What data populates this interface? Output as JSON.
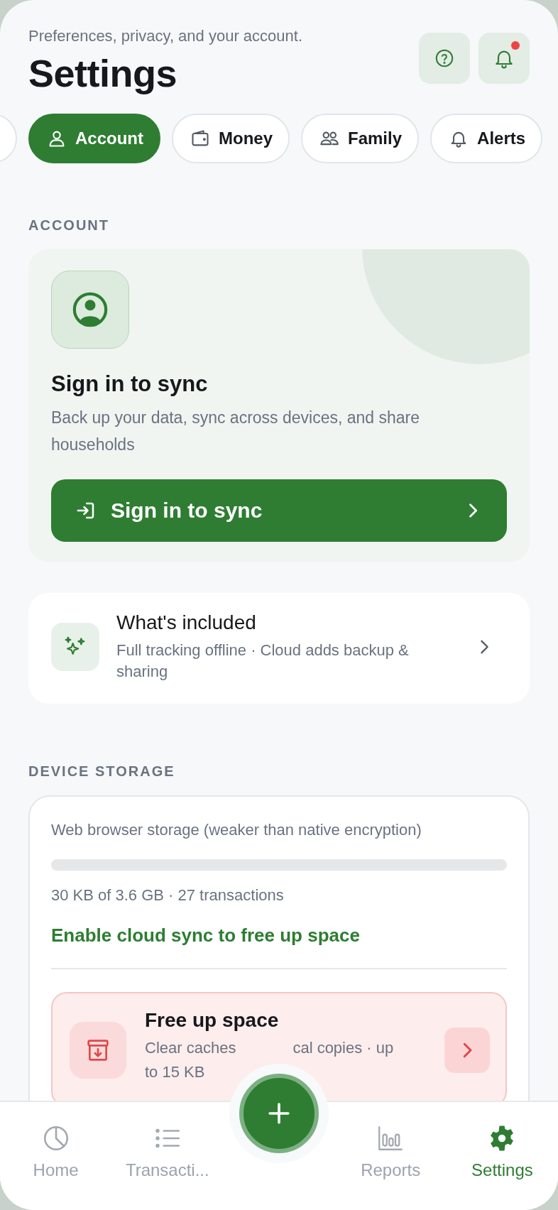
{
  "header": {
    "subtitle": "Preferences, privacy, and your account.",
    "title": "Settings",
    "actions": [
      {
        "kind": "help"
      },
      {
        "kind": "notifications",
        "unread": true
      }
    ]
  },
  "tabs": [
    {
      "label": "Account",
      "selected": true
    },
    {
      "label": "Money",
      "selected": false
    },
    {
      "label": "Family",
      "selected": false
    },
    {
      "label": "Alerts",
      "selected": false
    }
  ],
  "account": {
    "heading": "ACCOUNT",
    "title": "Sign in to sync",
    "description": "Back up your data, sync across devices, and share households",
    "button": "Sign in to sync"
  },
  "included": {
    "title": "What's included",
    "description": "Full tracking offline · Cloud adds backup & sharing"
  },
  "storage": {
    "heading": "DEVICE STORAGE",
    "label": "Web browser storage (weaker than native encryption)",
    "level": 0,
    "usage": "30 KB of 3.6 GB · 27 transactions",
    "link": "Enable cloud sync to free up space",
    "free_up": {
      "title": "Free up space",
      "description_parts": [
        "Clear caches",
        "cal copies · up",
        "to 15 KB"
      ]
    }
  },
  "nav": [
    {
      "label": "Home",
      "selected": false
    },
    {
      "label": "Transacti...",
      "selected": false
    },
    {
      "label": "Reports",
      "selected": false
    },
    {
      "label": "Settings",
      "selected": true
    }
  ]
}
